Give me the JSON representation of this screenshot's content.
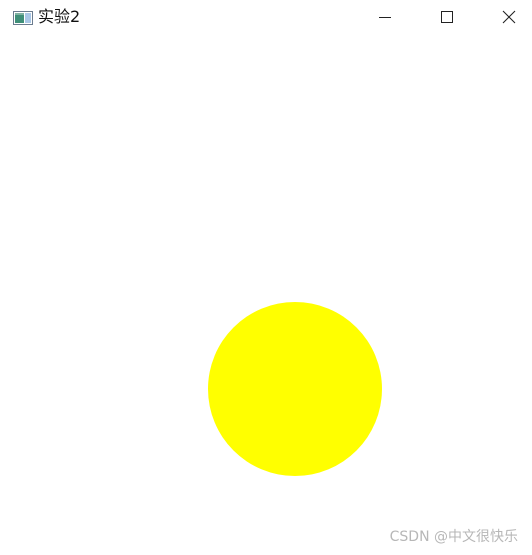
{
  "window": {
    "title": "实验2",
    "app_icon": "window-app-icon",
    "controls": {
      "minimize_icon": "minimize-icon",
      "maximize_icon": "maximize-icon",
      "close_icon": "close-icon"
    }
  },
  "canvas": {
    "background": "#ffffff",
    "shape": {
      "type": "circle",
      "color": "#ffff00"
    }
  },
  "watermark": {
    "text": "CSDN @中文很快乐"
  }
}
